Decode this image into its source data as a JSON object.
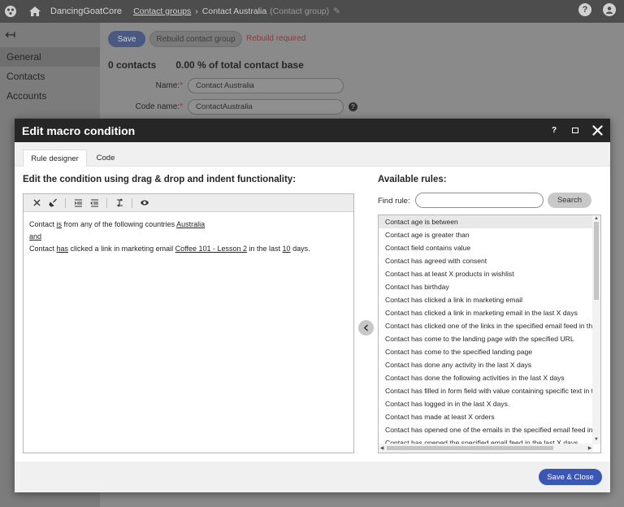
{
  "topbar": {
    "site_name": "DancingGoatCore",
    "breadcrumb_parent": "Contact groups",
    "breadcrumb_current": "Contact Australia",
    "breadcrumb_type": "(Contact group)",
    "help_glyph": "?",
    "user_glyph": "●"
  },
  "sidebar": {
    "back_glyph": "↤",
    "items": [
      {
        "label": "General"
      },
      {
        "label": "Contacts"
      },
      {
        "label": "Accounts"
      }
    ]
  },
  "page": {
    "save_label": "Save",
    "rebuild_label": "Rebuild contact group",
    "rebuild_status": "Rebuild required",
    "contacts_count": "0 contacts",
    "contact_base": "0.00 % of total contact base",
    "name_label": "Name:",
    "name_value": "Contact Australia",
    "code_name_label": "Code name:",
    "code_name_value": "ContactAustralia",
    "required_mark": "*"
  },
  "modal": {
    "title": "Edit macro condition",
    "help_glyph": "?",
    "close_glyph": "✕",
    "tabs": [
      {
        "label": "Rule designer"
      },
      {
        "label": "Code"
      }
    ],
    "editor_heading": "Edit the condition using drag & drop and indent functionality:",
    "rules_heading": "Available rules:",
    "find_label": "Find rule:",
    "find_value": "",
    "search_label": "Search",
    "condition": {
      "line1_pre": "Contact ",
      "line1_op": "is",
      "line1_mid": " from any of the following countries ",
      "line1_val": "Australia",
      "connector": "and",
      "line2_pre": "Contact ",
      "line2_op": "has",
      "line2_mid": " clicked a link in marketing email ",
      "line2_email": "Coffee 101 - Lesson 2",
      "line2_mid2": " in the last ",
      "line2_days": "10",
      "line2_end": " days."
    },
    "rules": [
      "Contact age is between",
      "Contact age is greater than",
      "Contact field contains value",
      "Contact has agreed with consent",
      "Contact has at least X products in wishlist",
      "Contact has birthday",
      "Contact has clicked a link in marketing email",
      "Contact has clicked a link in marketing email in the last X days",
      "Contact has clicked one of the links in the specified email feed in the",
      "Contact has come to the landing page with the specified URL",
      "Contact has come to the specified landing page",
      "Contact has done any activity in the last X days",
      "Contact has done the following activities in the last X days",
      "Contact has filled in form field with value containing specific text in th",
      "Contact has logged in in the last X days.",
      "Contact has made at least X orders",
      "Contact has opened one of the emails in the specified email feed in th",
      "Contact has opened the specified email feed in the last X days"
    ],
    "save_close_label": "Save & Close"
  }
}
